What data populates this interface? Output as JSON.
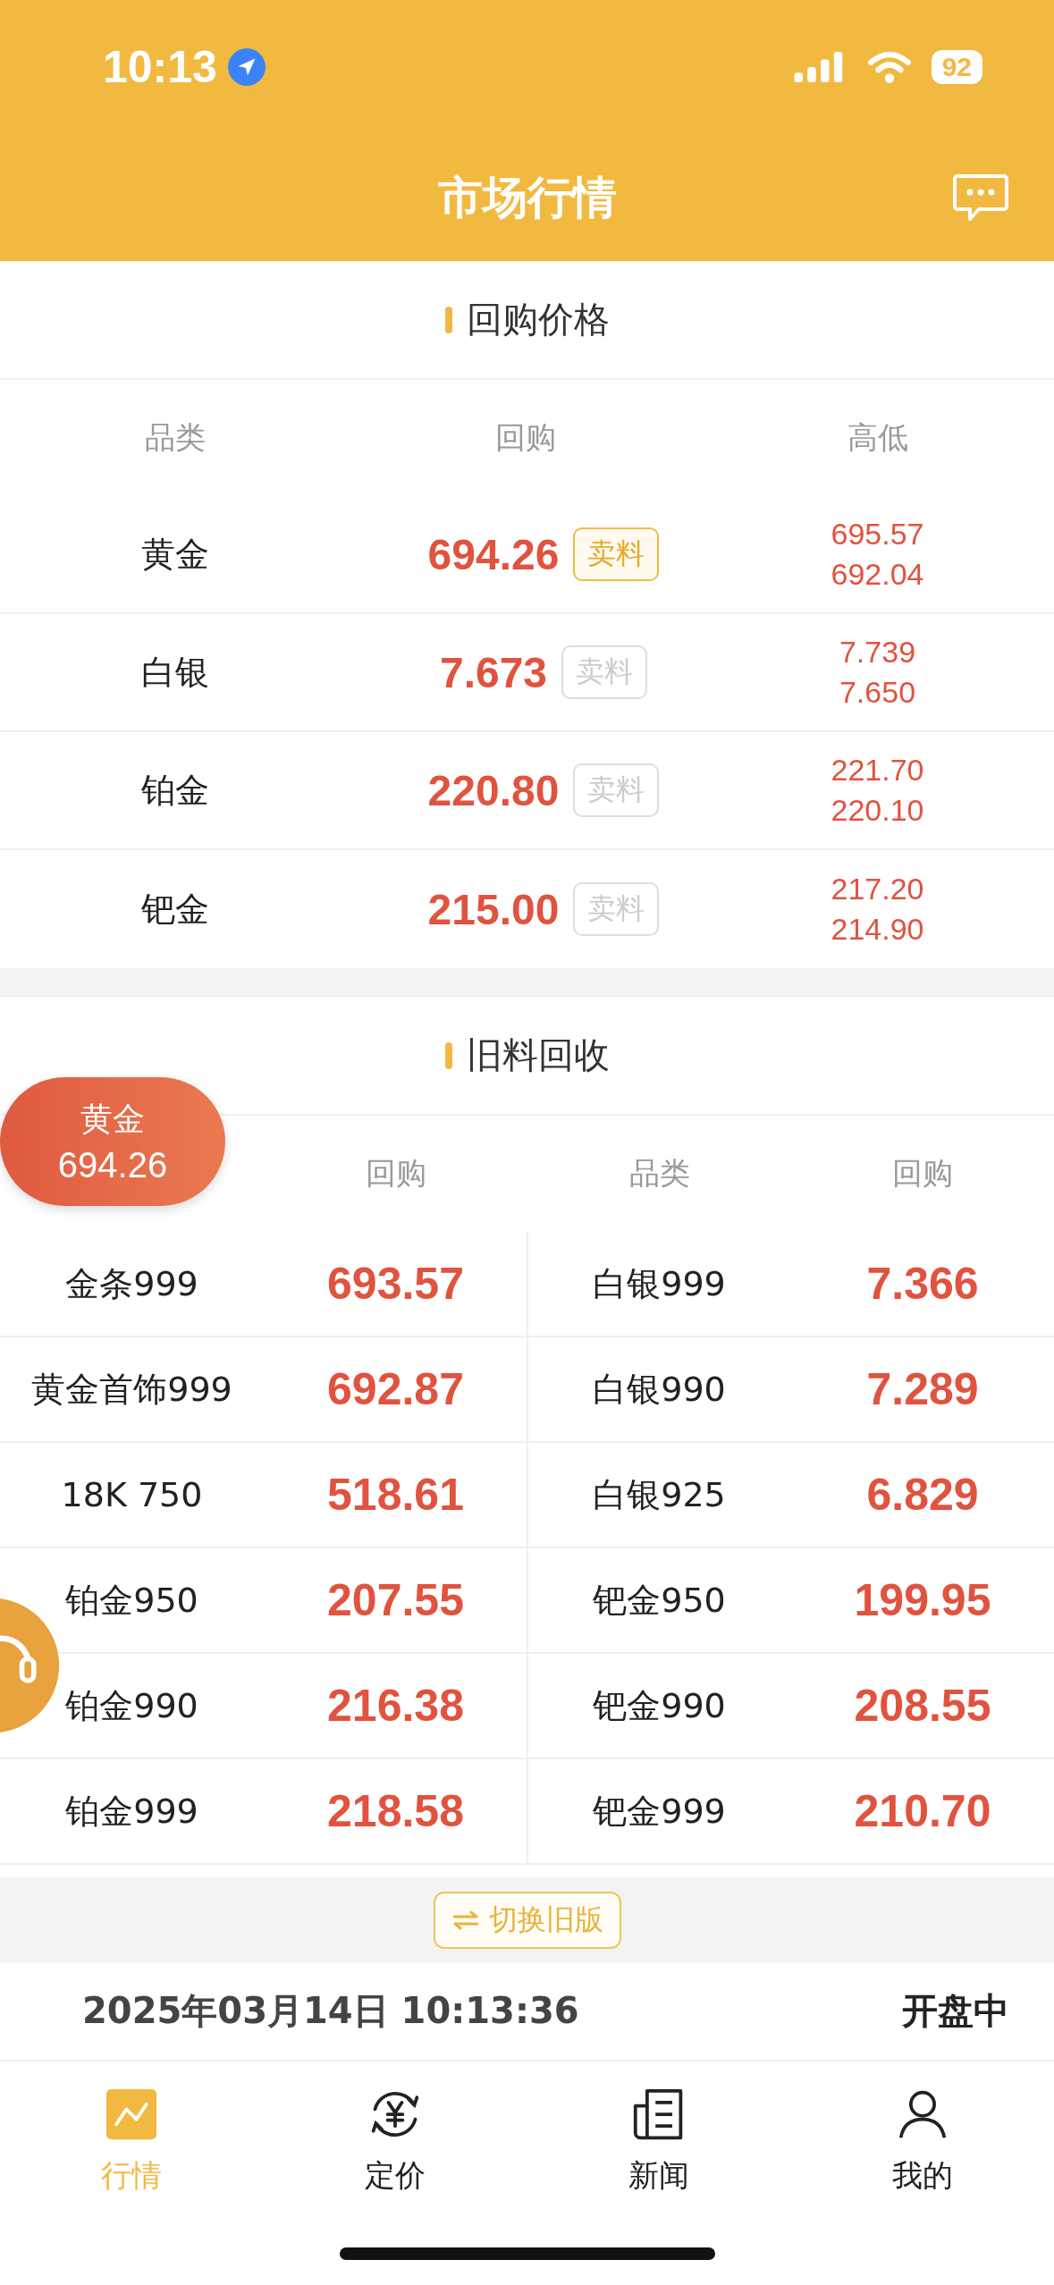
{
  "status_bar": {
    "time": "10:13",
    "battery": "92"
  },
  "header": {
    "title": "市场行情"
  },
  "buyback": {
    "title": "回购价格",
    "columns": [
      "品类",
      "回购",
      "高低"
    ],
    "rows": [
      {
        "name": "黄金",
        "price": "694.26",
        "badge": "卖料",
        "active": true,
        "high": "695.57",
        "low": "692.04"
      },
      {
        "name": "白银",
        "price": "7.673",
        "badge": "卖料",
        "active": false,
        "high": "7.739",
        "low": "7.650"
      },
      {
        "name": "铂金",
        "price": "220.80",
        "badge": "卖料",
        "active": false,
        "high": "221.70",
        "low": "220.10"
      },
      {
        "name": "钯金",
        "price": "215.00",
        "badge": "卖料",
        "active": false,
        "high": "217.20",
        "low": "214.90"
      }
    ]
  },
  "recycle": {
    "title": "旧料回收",
    "columns": [
      "回购",
      "品类",
      "回购"
    ],
    "rows": [
      {
        "left_name": "金条999",
        "left_price": "693.57",
        "right_name": "白银999",
        "right_price": "7.366"
      },
      {
        "left_name": "黄金首饰999",
        "left_price": "692.87",
        "right_name": "白银990",
        "right_price": "7.289"
      },
      {
        "left_name": "18K 750",
        "left_price": "518.61",
        "right_name": "白银925",
        "right_price": "6.829"
      },
      {
        "left_name": "铂金950",
        "left_price": "207.55",
        "right_name": "钯金950",
        "right_price": "199.95"
      },
      {
        "left_name": "铂金990",
        "left_price": "216.38",
        "right_name": "钯金990",
        "right_price": "208.55"
      },
      {
        "left_name": "铂金999",
        "left_price": "218.58",
        "right_name": "钯金999",
        "right_price": "210.70"
      }
    ]
  },
  "floating_price": {
    "name": "黄金",
    "price": "694.26"
  },
  "switch_button": {
    "label": "切换旧版"
  },
  "footer": {
    "datetime": "2025年03月14日 10:13:36",
    "status": "开盘中"
  },
  "tabs": [
    {
      "label": "行情",
      "kind": "chart",
      "selected": true
    },
    {
      "label": "定价",
      "kind": "yen",
      "selected": false
    },
    {
      "label": "新闻",
      "kind": "news",
      "selected": false
    },
    {
      "label": "我的",
      "kind": "user",
      "selected": false
    }
  ]
}
